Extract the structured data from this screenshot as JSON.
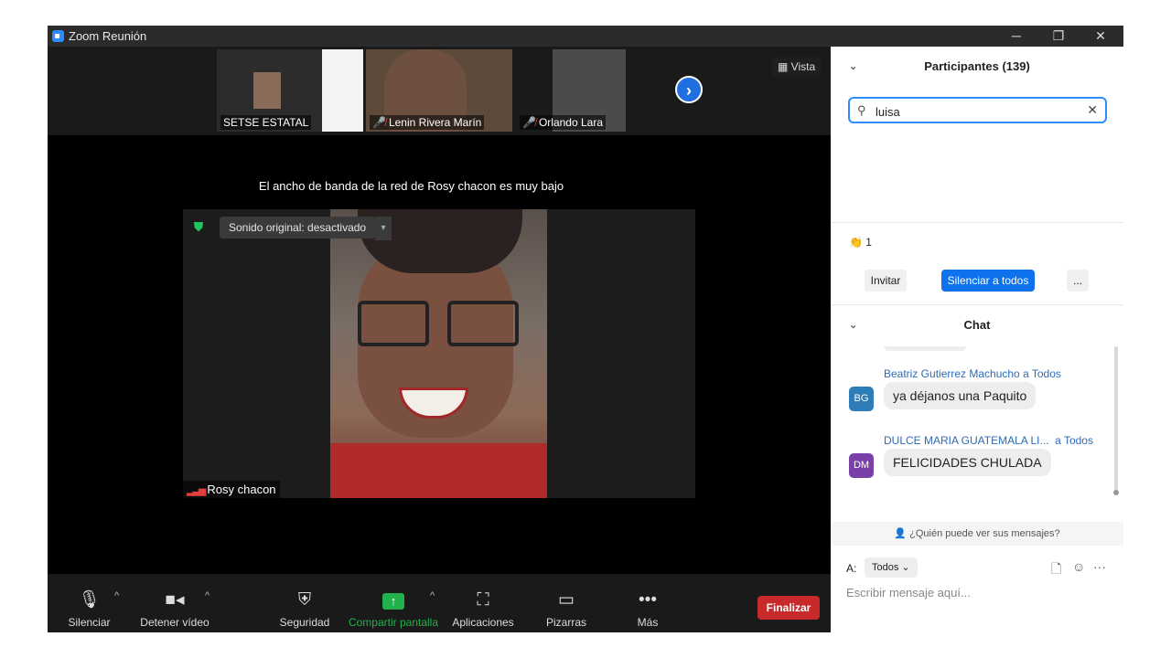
{
  "window": {
    "title": "Zoom Reunión",
    "controls": [
      "─",
      "❐",
      "✕"
    ]
  },
  "thumbnails": [
    {
      "name": "SETSE ESTATAL",
      "muted": false
    },
    {
      "name": "Lenin Rivera Marín",
      "muted": true
    },
    {
      "name": "Orlando Lara",
      "muted": true
    }
  ],
  "view_button": {
    "icon": "grid-icon",
    "label": "Vista"
  },
  "next_icon": "›",
  "notice": "El ancho de banda de la red de Rosy chacon es muy bajo",
  "main_video": {
    "original_sound": "Sonido original: desactivado",
    "name": "Rosy chacon"
  },
  "toolbar": {
    "mute": "Silenciar",
    "video": "Detener vídeo",
    "security": "Seguridad",
    "share": "Compartir pantalla",
    "apps": "Aplicaciones",
    "whiteboards": "Pizarras",
    "more": "Más",
    "end": "Finalizar"
  },
  "participants": {
    "title": "Participantes (139)",
    "search_value": "luisa",
    "reaction_count": "1",
    "invite": "Invitar",
    "mute_all": "Silenciar a todos",
    "more": "..."
  },
  "chat": {
    "title": "Chat",
    "messages": [
      {
        "initials": "BG",
        "sender": "Beatriz Gutierrez Machucho",
        "to": "a Todos",
        "text": "ya déjanos una Paquito",
        "color": "#2e7db8"
      },
      {
        "initials": "DM",
        "sender": "DULCE MARIA GUATEMALA LI...",
        "to": "a Todos",
        "text": "FELICIDADES CHULADA",
        "color": "#7b3fa8"
      }
    ],
    "who_can_see": "¿Quién puede ver sus mensajes?",
    "to_label": "A:",
    "to_value": "Todos",
    "placeholder": "Escribir mensaje aquí..."
  },
  "colors": {
    "accent": "#2d8cff",
    "end": "#c8292b",
    "share": "#23b14d"
  }
}
